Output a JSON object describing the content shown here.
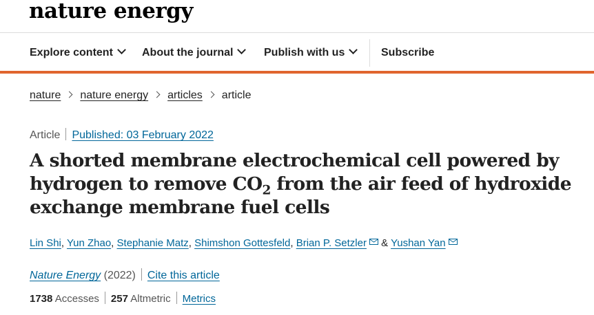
{
  "site": {
    "logo": "nature energy"
  },
  "nav": {
    "items": [
      {
        "label": "Explore content"
      },
      {
        "label": "About the journal"
      },
      {
        "label": "Publish with us"
      }
    ],
    "subscribe": "Subscribe"
  },
  "breadcrumb": [
    "nature",
    "nature energy",
    "articles",
    "article"
  ],
  "article": {
    "type": "Article",
    "published": "Published: 03 February 2022",
    "title_part1": "A shorted membrane electrochemical cell powered by hydrogen to remove CO",
    "title_sub": "2",
    "title_part2": " from the air feed of hydroxide exchange membrane fuel cells",
    "authors": [
      "Lin Shi",
      "Yun Zhao",
      "Stephanie Matz",
      "Shimshon Gottesfeld",
      "Brian P. Setzler",
      "Yushan Yan"
    ],
    "authors_joiner": "&",
    "journal": "Nature Energy",
    "year": "(2022)",
    "cite": "Cite this article",
    "accesses_count": "1738",
    "accesses_label": "Accesses",
    "altmetric_count": "257",
    "altmetric_label": "Altmetric",
    "metrics_link": "Metrics"
  },
  "colors": {
    "accent": "#e0652e",
    "link": "#006699",
    "text": "#222222"
  },
  "icons": [
    "chevron-down-icon",
    "chevron-right-icon",
    "mail-icon"
  ]
}
